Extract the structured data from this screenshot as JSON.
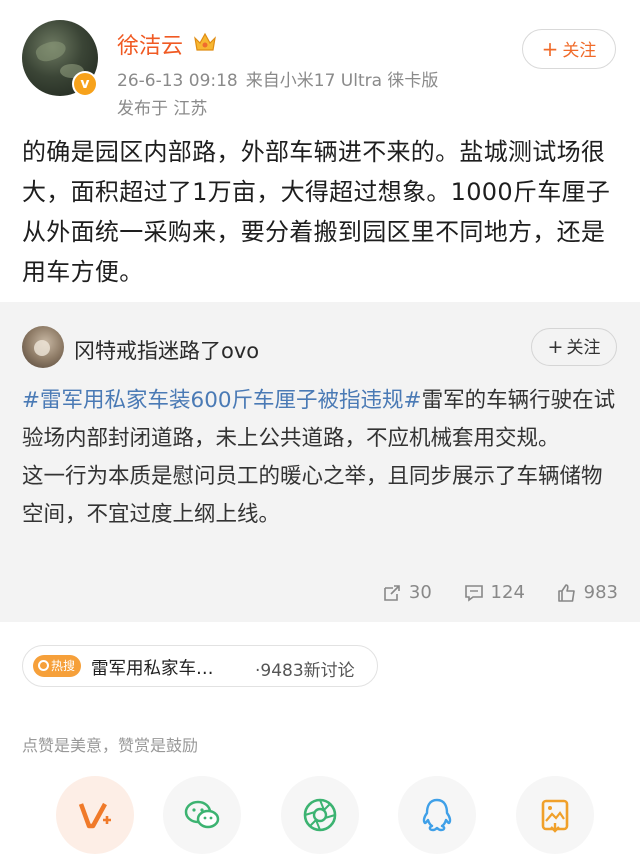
{
  "post": {
    "username": "徐洁云",
    "date": "26-6-13 09:18",
    "source": "来自小米17 Ultra 徕卡版",
    "location": "发布于 江苏",
    "follow_label": "关注",
    "text": "的确是园区内部路，外部车辆进不来的。盐城测试场很大，面积超过了1万亩，大得超过想象。1000斤车厘子从外面统一采购来，要分着搬到园区里不同地方，还是用车方便。"
  },
  "repost": {
    "username": "冈特戒指迷路了ovo",
    "follow_label": "关注",
    "hashtag": "#雷军用私家车装600斤车厘子被指违规#",
    "text_part1": "雷军的车辆行驶在试验场内部封闭道路，未上公共道路，不应机械套用交规。",
    "text_part2": "这一行为本质是慰问员工的暖心之举，且同步展示了车辆储物空间，不宜过度上纲上线。",
    "reposts": "30",
    "comments": "124",
    "likes": "983"
  },
  "topic": {
    "badge": "热搜",
    "title": "雷军用私家车…",
    "count": "·9483新讨论"
  },
  "reward_hint": "点赞是美意，赞赏是鼓励",
  "share_icons": [
    "vplus-icon",
    "wechat-icon",
    "moments-icon",
    "qq-icon",
    "save-image-icon"
  ],
  "colors": {
    "accent": "#f05a23",
    "link": "#4a7ab5",
    "hot": "#f6a03a"
  }
}
